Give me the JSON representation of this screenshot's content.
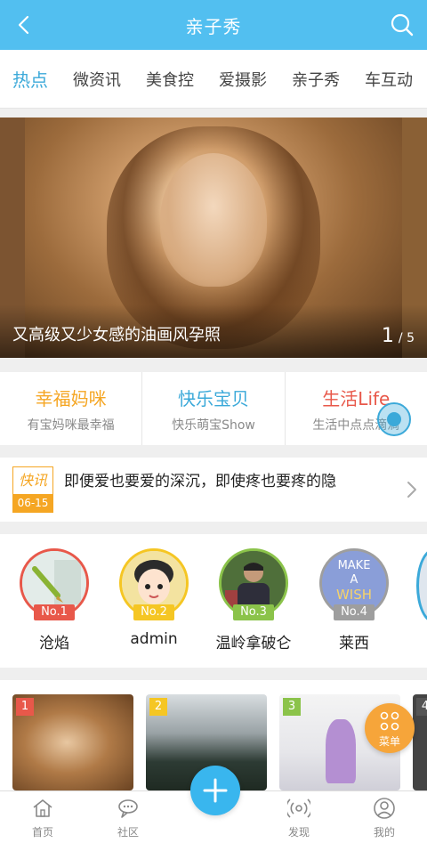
{
  "header": {
    "title": "亲子秀"
  },
  "tabs": [
    {
      "label": "热点"
    },
    {
      "label": "微资讯"
    },
    {
      "label": "美食控"
    },
    {
      "label": "爱摄影"
    },
    {
      "label": "亲子秀"
    },
    {
      "label": "车互动"
    }
  ],
  "banner": {
    "caption": "又高级又少女感的油画风孕照",
    "current": "1",
    "total": "/ 5"
  },
  "categories": [
    {
      "name": "幸福妈咪",
      "sub": "有宝妈咪最幸福",
      "color": "#f5a623"
    },
    {
      "name": "快乐宝贝",
      "sub": "快乐萌宝Show",
      "color": "#3ba9d9"
    },
    {
      "name": "生活Life",
      "sub": "生活中点点滴滴",
      "color": "#e8584a"
    }
  ],
  "news": {
    "badge": "快讯",
    "date": "06-15",
    "text": "即便爱也要爱的深沉，即使疼也要疼的隐"
  },
  "users": [
    {
      "name": "沧焰",
      "rank": "No.1",
      "color": "#e8584a"
    },
    {
      "name": "admin",
      "rank": "No.2",
      "color": "#f5c623"
    },
    {
      "name": "温岭拿破仑",
      "rank": "No.3",
      "color": "#8bc34a"
    },
    {
      "name": "莱西",
      "rank": "No.4",
      "color": "#9e9e9e"
    }
  ],
  "avatar_art": {
    "user4_line1": "MAKE",
    "user4_line2": "A",
    "user4_line3": "WISH"
  },
  "thumbs": [
    {
      "num": "1",
      "color": "#e8584a"
    },
    {
      "num": "2",
      "color": "#f5c623"
    },
    {
      "num": "3",
      "color": "#8bc34a"
    },
    {
      "num": "4",
      "color": "#555555"
    }
  ],
  "menu_label": "菜单",
  "nav": [
    {
      "label": "首页"
    },
    {
      "label": "社区"
    },
    {
      "label": "发现"
    },
    {
      "label": "我的"
    }
  ],
  "colors": {
    "header": "#52bff0",
    "accent": "#3ba9d9",
    "plus": "#39b6ee",
    "menu": "#f6a53a"
  }
}
